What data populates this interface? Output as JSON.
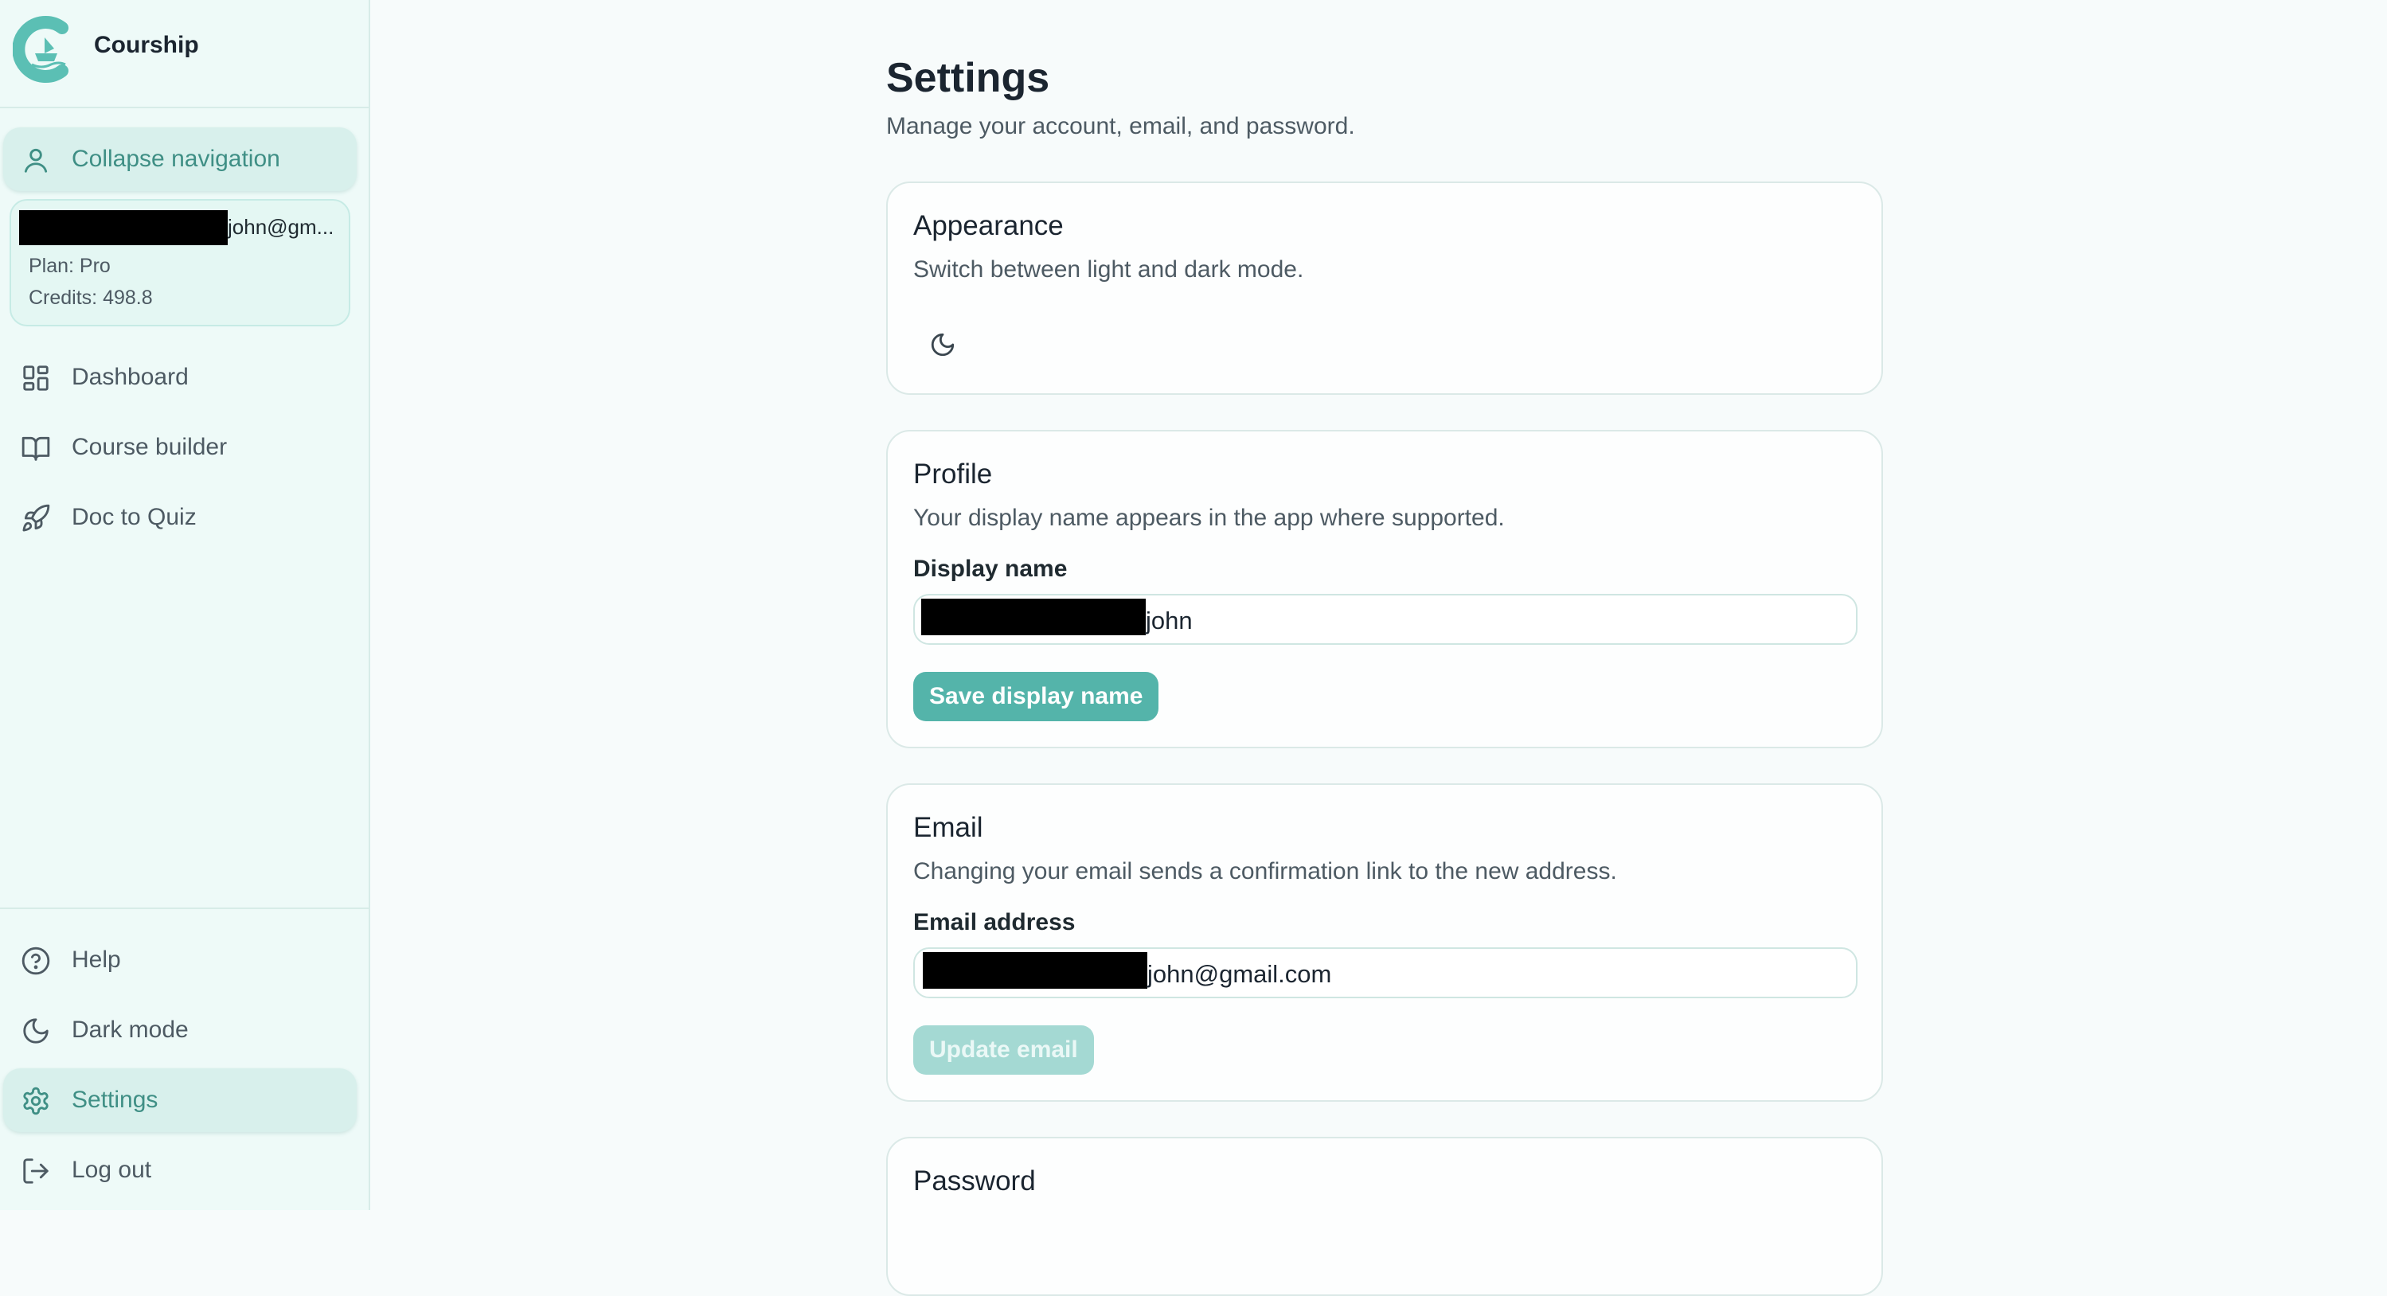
{
  "app": {
    "name": "Courship"
  },
  "sidebar": {
    "collapse_label": "Collapse navigation",
    "user": {
      "email": "john@gm...",
      "plan": "Plan: Pro",
      "credits": "Credits: 498.8"
    },
    "items": [
      {
        "label": "Dashboard",
        "icon": "layout-grid-icon"
      },
      {
        "label": "Course builder",
        "icon": "book-open-icon"
      },
      {
        "label": "Doc to Quiz",
        "icon": "rocket-icon"
      }
    ],
    "bottom_items": [
      {
        "label": "Help",
        "icon": "help-circle-icon"
      },
      {
        "label": "Dark mode",
        "icon": "moon-icon"
      },
      {
        "label": "Settings",
        "icon": "gear-icon",
        "active": true
      },
      {
        "label": "Log out",
        "icon": "log-out-icon"
      }
    ]
  },
  "page": {
    "title": "Settings",
    "subtitle": "Manage your account, email, and password."
  },
  "appearance": {
    "title": "Appearance",
    "description": "Switch between light and dark mode.",
    "toggle_icon": "moon-icon"
  },
  "profile": {
    "title": "Profile",
    "description": "Your display name appears in the app where supported.",
    "field_label": "Display name",
    "value": "john",
    "button": "Save display name"
  },
  "email": {
    "title": "Email",
    "description": "Changing your email sends a confirmation link to the new address.",
    "field_label": "Email address",
    "value": "john@gmail.com",
    "button": "Update email"
  },
  "password": {
    "title": "Password"
  },
  "colors": {
    "accent": "#54b4aa",
    "accent_disabled": "#a4d9d3",
    "sidebar_bg": "#eefaf8",
    "active_text": "#3f8f85"
  }
}
